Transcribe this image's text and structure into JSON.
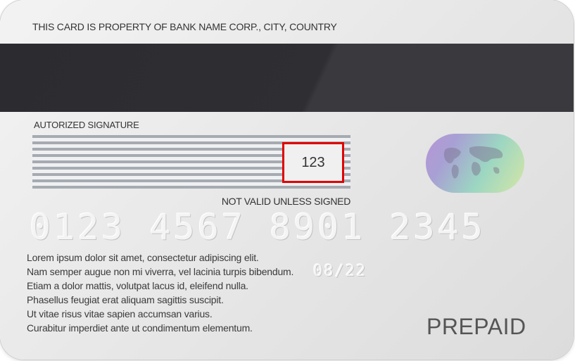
{
  "card": {
    "property_text": "THIS CARD IS PROPERTY OF BANK NAME  CORP.,  CITY, COUNTRY",
    "signature_label": "AUTORIZED SIGNATURE",
    "cvv": "123",
    "not_valid_text": "NOT VALID UNLESS SIGNED",
    "card_number": "0123 4567 8901 2345",
    "expiry": "08/22",
    "lorem_lines": [
      "Lorem ipsum dolor sit amet, consectetur adipiscing elit.",
      "Nam semper augue non mi viverra, vel lacinia turpis bibendum.",
      "Etiam a dolor mattis, volutpat lacus id, eleifend nulla.",
      "Phasellus feugiat erat aliquam sagittis suscipit.",
      "Ut vitae risus vitae sapien accumsan varius.",
      "Curabitur imperdiet ante ut condimentum elementum."
    ],
    "card_type": "PREPAID"
  },
  "colors": {
    "highlight_border": "#e00000",
    "magnetic_stripe": "#2f2f33"
  }
}
